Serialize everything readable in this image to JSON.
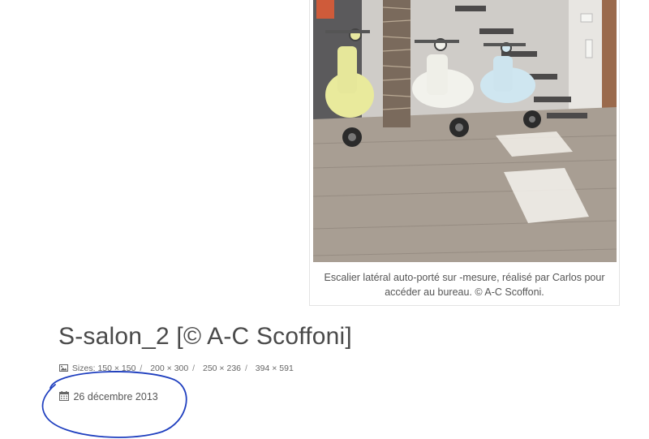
{
  "attachment": {
    "caption": "Escalier latéral auto-porté sur -mesure, réalisé par Carlos pour accéder au bureau. © A-C Scoffoni.",
    "title": "S-salon_2 [© A-C Scoffoni]",
    "sizes_label": "Sizes:",
    "sizes": [
      "150 × 150",
      "200 × 300",
      "250 × 236",
      "394 × 591"
    ],
    "separator": "/",
    "date": "26 décembre 2013"
  },
  "icons": {
    "sizes": "image-icon",
    "date": "calendar-icon"
  },
  "colors": {
    "annotation_ink": "#1f3fbf",
    "text": "#555555",
    "title": "#4a4a4a",
    "border": "#e3e3e3"
  }
}
